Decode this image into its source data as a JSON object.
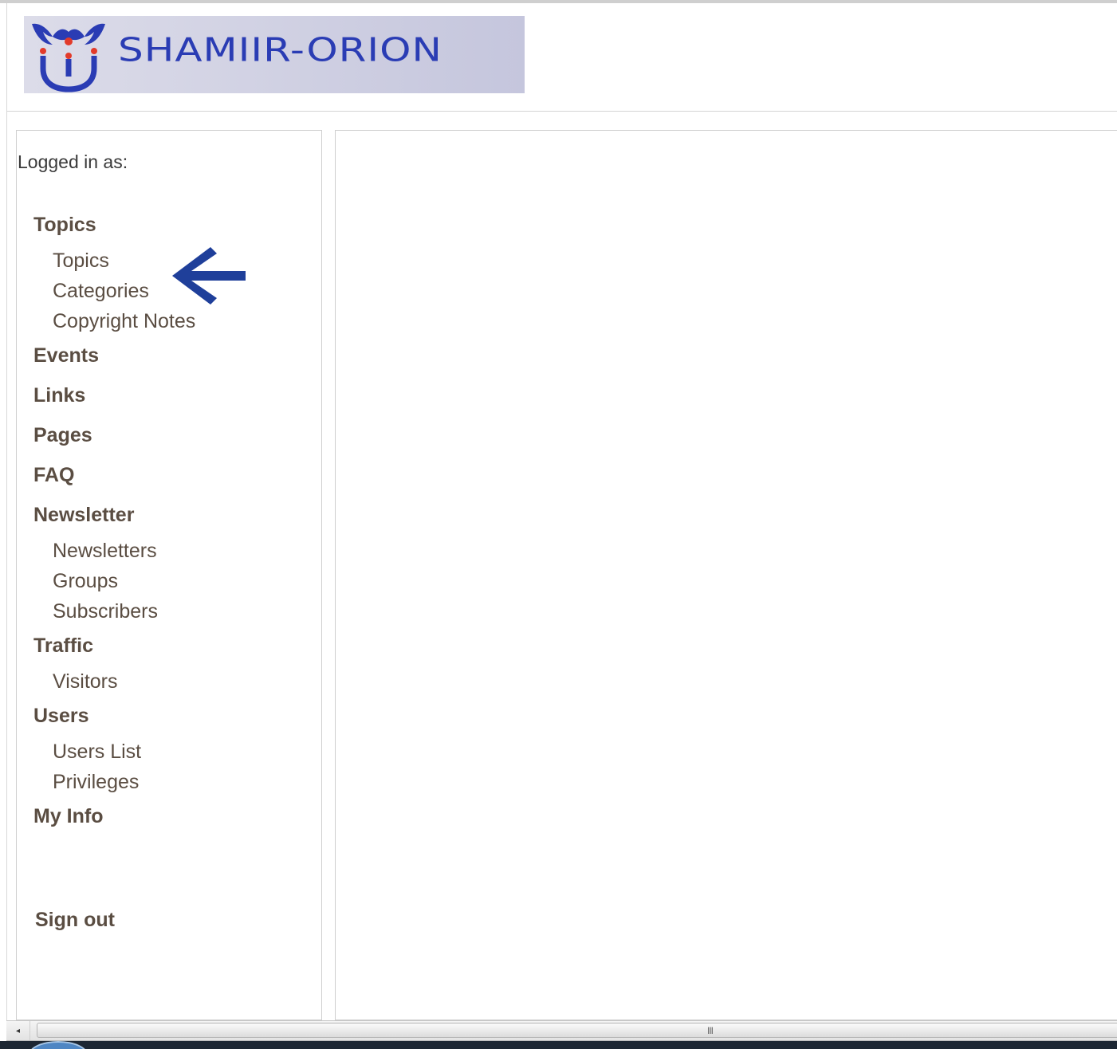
{
  "header": {
    "logo_text": "SHAMIIR-ORION",
    "logo_bg_colors": [
      "#dcdce9",
      "#c5c6dd"
    ],
    "logo_text_color": "#2a3cb4"
  },
  "sidebar": {
    "logged_in_label": "Logged in as:",
    "sections": [
      {
        "label": "Topics",
        "items": [
          "Topics",
          "Categories",
          "Copyright Notes"
        ]
      },
      {
        "label": "Events",
        "items": []
      },
      {
        "label": "Links",
        "items": []
      },
      {
        "label": "Pages",
        "items": []
      },
      {
        "label": "FAQ",
        "items": []
      },
      {
        "label": "Newsletter",
        "items": [
          "Newsletters",
          "Groups",
          "Subscribers"
        ]
      },
      {
        "label": "Traffic",
        "items": [
          "Visitors"
        ]
      },
      {
        "label": "Users",
        "items": [
          "Users List",
          "Privileges"
        ]
      },
      {
        "label": "My Info",
        "items": []
      }
    ],
    "sign_out_label": "Sign out",
    "link_color": "#5a4d42"
  },
  "annotation": {
    "arrow_icon": "arrow-left-icon",
    "arrow_color": "#1f3f9a"
  },
  "scrollbar": {
    "left_arrow_icon": "◂",
    "grip_icon": "III"
  }
}
